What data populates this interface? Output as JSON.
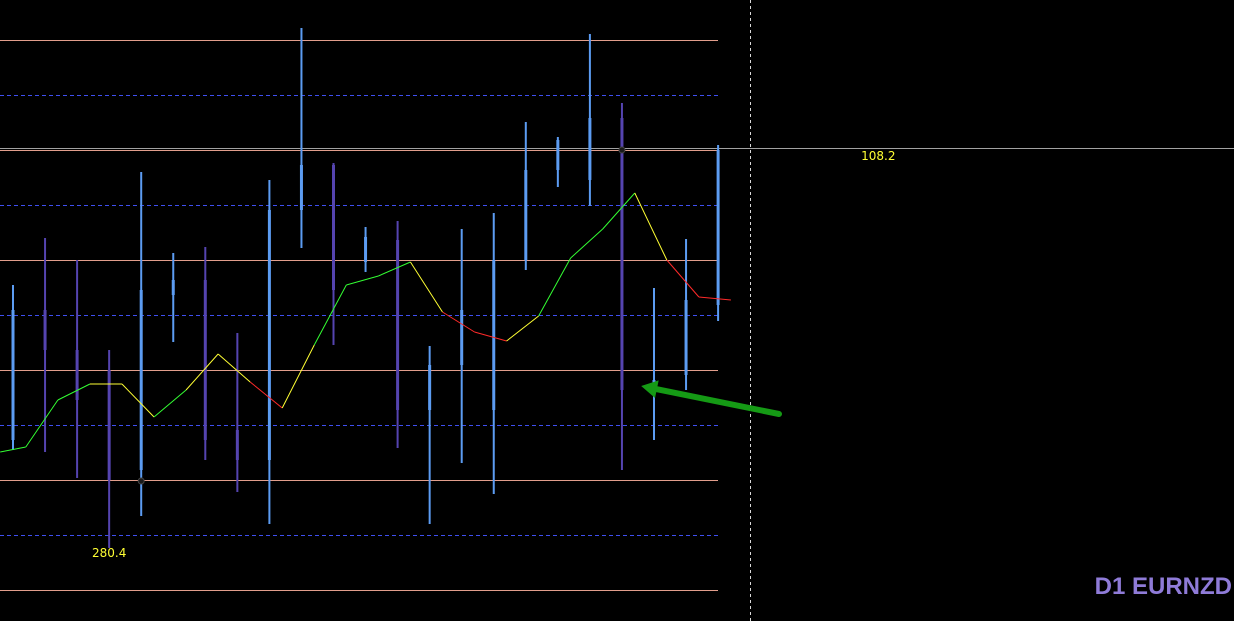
{
  "symbol_label": "D1 EURNZD",
  "colors": {
    "background": "#000000",
    "level_line": "#e29e8c",
    "dashed_line": "#3f4ff0",
    "crosshair": "#d8d8d8",
    "candle_light": "#5c9cf2",
    "candle_dark": "#5544b0",
    "label_text": "#ffff33",
    "symbol_text": "#8f7bd8",
    "arrow": "#159a15",
    "trend_up": "#33ff33",
    "trend_mid": "#ffff33",
    "trend_down": "#ff2a2a"
  },
  "chart_data": {
    "type": "candlestick",
    "y_range": [
      0,
      621
    ],
    "x_index_range": [
      -1,
      31
    ],
    "solid_levels": [
      40,
      150,
      260,
      370,
      480,
      590
    ],
    "dashed_levels": [
      95,
      205,
      315,
      425,
      535
    ],
    "crosshair_level": 148,
    "annotations": [
      {
        "text": "108.2",
        "index": 27,
        "value": 156
      },
      {
        "text": "280.4",
        "index": 3,
        "value": 553
      }
    ],
    "candles": [
      {
        "index": 0,
        "high": 285,
        "low": 450,
        "open": 310,
        "close": 440,
        "shade": "light"
      },
      {
        "index": 1,
        "high": 238,
        "low": 452,
        "open": 310,
        "close": 350,
        "shade": "dark"
      },
      {
        "index": 2,
        "high": 260,
        "low": 478,
        "open": 350,
        "close": 400,
        "shade": "dark"
      },
      {
        "index": 3,
        "high": 350,
        "low": 548,
        "open": 370,
        "close": 480,
        "shade": "dark"
      },
      {
        "index": 4,
        "high": 172,
        "low": 516,
        "open": 290,
        "close": 470,
        "shade": "light"
      },
      {
        "index": 5,
        "high": 253,
        "low": 342,
        "open": 280,
        "close": 295,
        "shade": "light"
      },
      {
        "index": 6,
        "high": 247,
        "low": 460,
        "open": 280,
        "close": 440,
        "shade": "dark"
      },
      {
        "index": 7,
        "high": 333,
        "low": 492,
        "open": 430,
        "close": 460,
        "shade": "dark"
      },
      {
        "index": 8,
        "high": 180,
        "low": 524,
        "open": 210,
        "close": 460,
        "shade": "light"
      },
      {
        "index": 9,
        "high": 28,
        "low": 248,
        "open": 165,
        "close": 210,
        "shade": "light"
      },
      {
        "index": 10,
        "high": 163,
        "low": 345,
        "open": 165,
        "close": 290,
        "shade": "dark"
      },
      {
        "index": 11,
        "high": 227,
        "low": 272,
        "open": 237,
        "close": 262,
        "shade": "light"
      },
      {
        "index": 12,
        "high": 221,
        "low": 448,
        "open": 240,
        "close": 410,
        "shade": "dark"
      },
      {
        "index": 13,
        "high": 346,
        "low": 524,
        "open": 365,
        "close": 410,
        "shade": "light"
      },
      {
        "index": 14,
        "high": 229,
        "low": 463,
        "open": 310,
        "close": 365,
        "shade": "light"
      },
      {
        "index": 15,
        "high": 213,
        "low": 494,
        "open": 260,
        "close": 410,
        "shade": "light"
      },
      {
        "index": 16,
        "high": 122,
        "low": 270,
        "open": 170,
        "close": 260,
        "shade": "light"
      },
      {
        "index": 17,
        "high": 137,
        "low": 187,
        "open": 140,
        "close": 170,
        "shade": "light"
      },
      {
        "index": 18,
        "high": 34,
        "low": 206,
        "open": 118,
        "close": 180,
        "shade": "light"
      },
      {
        "index": 19,
        "high": 103,
        "low": 470,
        "open": 118,
        "close": 390,
        "shade": "dark"
      },
      {
        "index": 20,
        "high": 288,
        "low": 440,
        "open": 380,
        "close": 390,
        "shade": "light"
      },
      {
        "index": 21,
        "high": 239,
        "low": 390,
        "open": 300,
        "close": 375,
        "shade": "light"
      },
      {
        "index": 22,
        "high": 145,
        "low": 321,
        "open": 150,
        "close": 305,
        "shade": "light"
      }
    ],
    "trend_line": [
      {
        "index": -0.4,
        "value": 452
      },
      {
        "index": 0.4,
        "value": 447
      },
      {
        "index": 1.4,
        "value": 400
      },
      {
        "index": 2.4,
        "value": 384
      },
      {
        "index": 3.4,
        "value": 384
      },
      {
        "index": 4.4,
        "value": 417
      },
      {
        "index": 5.4,
        "value": 390
      },
      {
        "index": 6.4,
        "value": 354
      },
      {
        "index": 7.4,
        "value": 382
      },
      {
        "index": 8.4,
        "value": 408
      },
      {
        "index": 9.4,
        "value": 345
      },
      {
        "index": 10.4,
        "value": 285
      },
      {
        "index": 11.4,
        "value": 276
      },
      {
        "index": 12.4,
        "value": 262
      },
      {
        "index": 13.4,
        "value": 312
      },
      {
        "index": 14.4,
        "value": 332
      },
      {
        "index": 15.4,
        "value": 341
      },
      {
        "index": 16.4,
        "value": 316
      },
      {
        "index": 17.4,
        "value": 258
      },
      {
        "index": 18.4,
        "value": 229
      },
      {
        "index": 19.4,
        "value": 193
      },
      {
        "index": 20.4,
        "value": 260
      },
      {
        "index": 21.4,
        "value": 297
      },
      {
        "index": 22.4,
        "value": 300
      }
    ],
    "trend_colors": [
      "trend_up",
      "trend_up",
      "trend_up",
      "trend_mid",
      "trend_mid",
      "trend_up",
      "trend_mid",
      "trend_mid",
      "trend_down",
      "trend_mid",
      "trend_up",
      "trend_up",
      "trend_up",
      "trend_mid",
      "trend_down",
      "trend_down",
      "trend_mid",
      "trend_up",
      "trend_up",
      "trend_up",
      "trend_mid",
      "trend_down",
      "trend_down"
    ],
    "markers": [
      {
        "index": 4,
        "value": 481
      },
      {
        "index": 19,
        "value": 150
      }
    ],
    "arrow": {
      "from": {
        "index": 23.9,
        "value": 414
      },
      "to": {
        "index": 19.6,
        "value": 386
      }
    }
  }
}
